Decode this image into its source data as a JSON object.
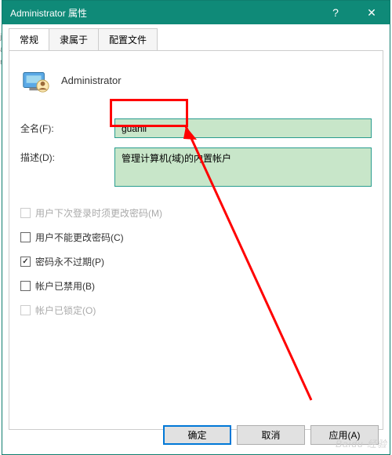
{
  "window": {
    "title": "Administrator 属性"
  },
  "tabs": [
    {
      "label": "常规",
      "active": true
    },
    {
      "label": "隶属于",
      "active": false
    },
    {
      "label": "配置文件",
      "active": false
    }
  ],
  "header": {
    "username": "Administrator"
  },
  "fields": {
    "fullname": {
      "label": "全名(F):",
      "value": "guanli"
    },
    "description": {
      "label": "描述(D):",
      "value": "管理计算机(域)的内置帐户"
    }
  },
  "checks": [
    {
      "label": "用户下次登录时须更改密码(M)",
      "checked": false,
      "disabled": true
    },
    {
      "label": "用户不能更改密码(C)",
      "checked": false,
      "disabled": false
    },
    {
      "label": "密码永不过期(P)",
      "checked": true,
      "disabled": false
    },
    {
      "label": "帐户已禁用(B)",
      "checked": false,
      "disabled": false
    },
    {
      "label": "帐户已锁定(O)",
      "checked": false,
      "disabled": true
    }
  ],
  "buttons": {
    "ok": "确定",
    "cancel": "取消",
    "apply": "应用(A)"
  },
  "titlebar": {
    "help": "?",
    "close": "✕"
  },
  "watermark": "Baidu 经验"
}
